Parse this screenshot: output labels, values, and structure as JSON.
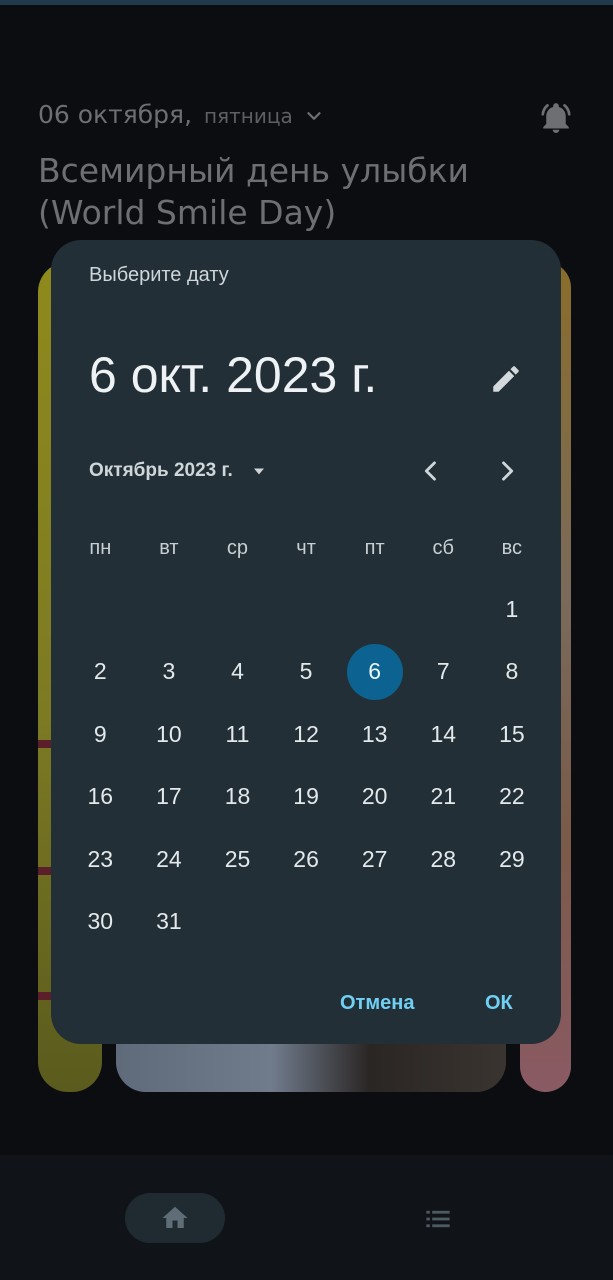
{
  "header": {
    "date": "06 октября,",
    "weekday": "пятница",
    "holiday_title": "Всемирный день улыбки (World Smile Day)"
  },
  "dialog": {
    "title": "Выберите дату",
    "selected_date": "6 окт. 2023 г.",
    "month_label": "Октябрь 2023 г.",
    "weekdays": [
      "пн",
      "вт",
      "ср",
      "чт",
      "пт",
      "сб",
      "вс"
    ],
    "weeks": [
      [
        "",
        "",
        "",
        "",
        "",
        "",
        "1"
      ],
      [
        "2",
        "3",
        "4",
        "5",
        "6",
        "7",
        "8"
      ],
      [
        "9",
        "10",
        "11",
        "12",
        "13",
        "14",
        "15"
      ],
      [
        "16",
        "17",
        "18",
        "19",
        "20",
        "21",
        "22"
      ],
      [
        "23",
        "24",
        "25",
        "26",
        "27",
        "28",
        "29"
      ],
      [
        "30",
        "31",
        "",
        "",
        "",
        "",
        ""
      ]
    ],
    "selected_day": "6",
    "cancel_label": "Отмена",
    "ok_label": "ОК"
  },
  "icons": {
    "date_dropdown": "chevron-down-icon",
    "alarm": "alarm-bell-icon",
    "edit": "pencil-icon",
    "month_dropdown": "caret-down-icon",
    "prev": "chevron-left-icon",
    "next": "chevron-right-icon",
    "home": "home-icon",
    "list": "list-icon"
  },
  "colors": {
    "background": "#0b0d10",
    "dialog": "#222f36",
    "accent": "#6fd0f4",
    "selected_day": "#0c6391"
  }
}
